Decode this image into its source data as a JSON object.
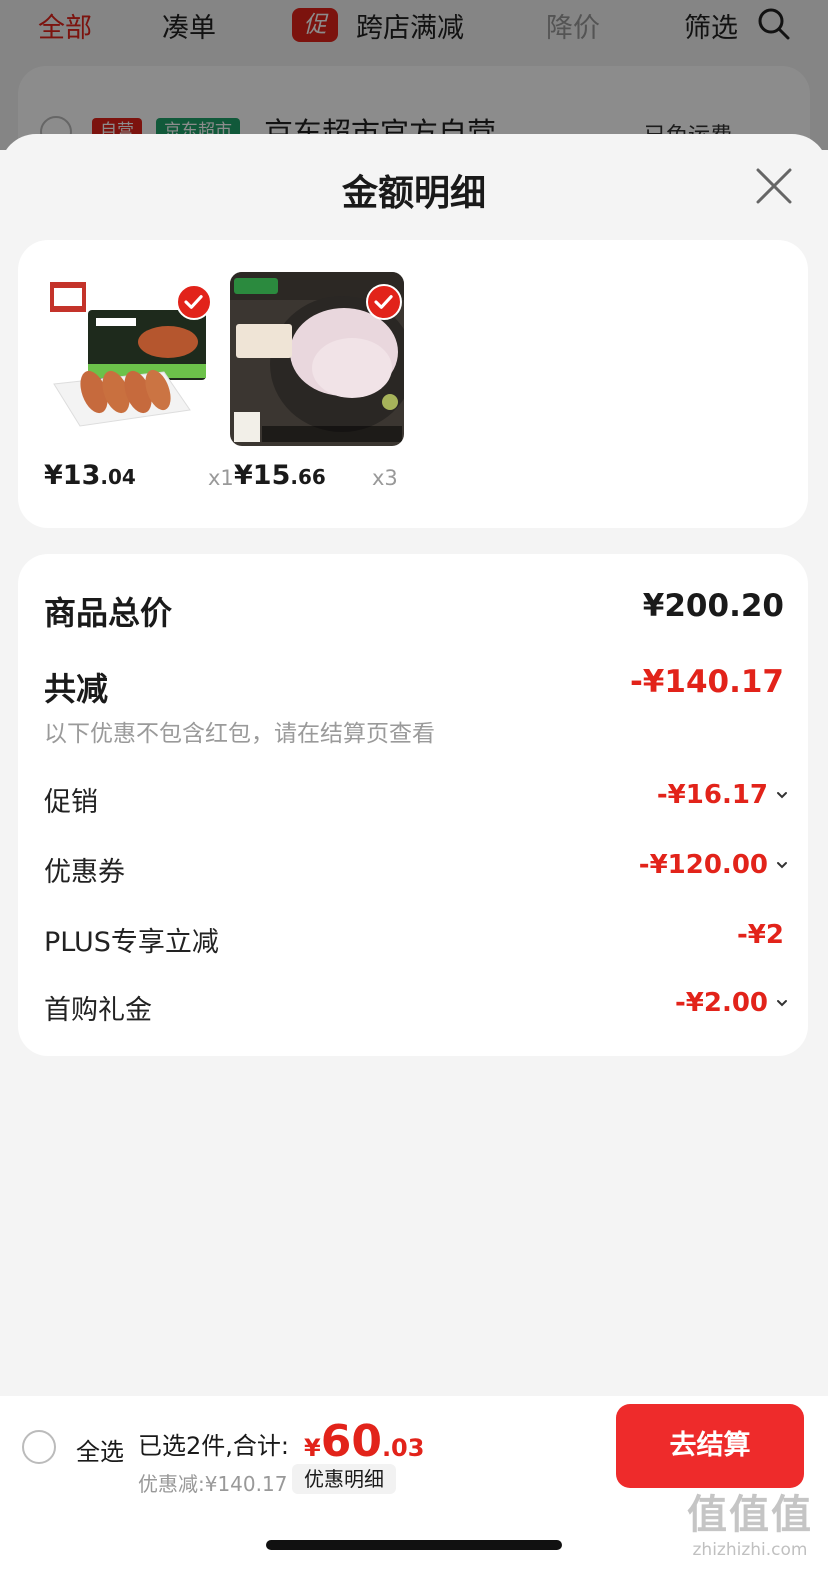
{
  "background": {
    "tabs": [
      {
        "label": "全部"
      },
      {
        "label": "凑单"
      },
      {
        "label": "跨店满减",
        "tag": "促"
      },
      {
        "label": "降价"
      },
      {
        "label": "筛选"
      }
    ],
    "shop": {
      "badges": [
        "自营",
        "京东超市"
      ],
      "name": "京东超市官方自营",
      "freight": "已免运费"
    }
  },
  "sheet": {
    "title": "金额明细",
    "products": [
      {
        "price_int": "¥13",
        "price_dec": ".04",
        "qty": "x1",
        "image": "sausage-product-image"
      },
      {
        "price_int": "¥15",
        "price_dec": ".66",
        "qty": "x3",
        "image": "pork-tripe-product-image"
      }
    ],
    "summary": {
      "total_label": "商品总价",
      "total_value": "¥200.20",
      "reduce_label": "共减",
      "reduce_value": "-¥140.17",
      "note": "以下优惠不包含红包，请在结算页查看",
      "items": [
        {
          "label": "促销",
          "value": "-¥16.17",
          "expandable": true
        },
        {
          "label": "优惠券",
          "value": "-¥120.00",
          "expandable": true
        },
        {
          "label": "PLUS专享立减",
          "value": "-¥2",
          "expandable": false
        },
        {
          "label": "首购礼金",
          "value": "-¥2.00",
          "expandable": true
        }
      ]
    }
  },
  "bottom_bar": {
    "select_all": "全选",
    "selected_info": "已选2件,合计:",
    "total_symbol": "¥",
    "total_int": "60",
    "total_dec": ".03",
    "discount": "优惠减:¥140.17",
    "detail_button": "优惠明细",
    "checkout_button": "去结算"
  },
  "watermark": {
    "main": "值值值",
    "url": "zhizhizhi.com"
  },
  "colors": {
    "accent": "#e2231a",
    "checkout": "#ee2b2b",
    "page_bg": "#f4f4f4"
  }
}
